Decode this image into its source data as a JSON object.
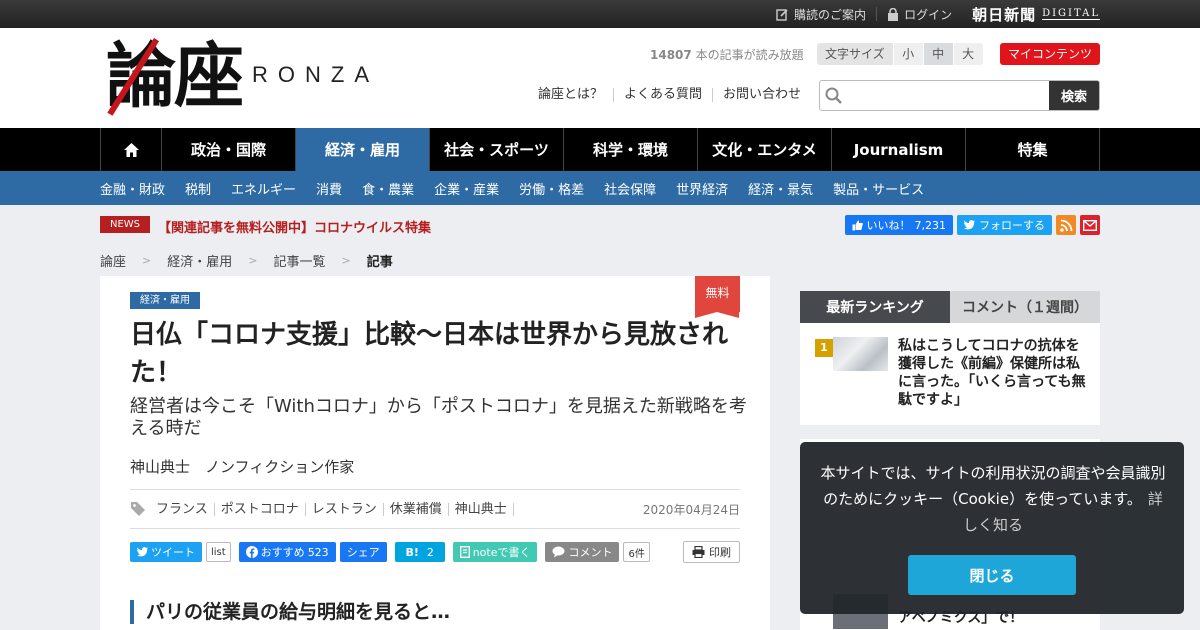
{
  "topbar": {
    "subscribe": "購読のご案内",
    "login": "ログイン",
    "asahi": "朝日新聞",
    "digital": "DIGITAL"
  },
  "header": {
    "logo_kanji": "論座",
    "logo_roman": "RONZA",
    "readers_count": "14807",
    "readers_suffix": " 本の記事が読み放題",
    "fontsize_label": "文字サイズ",
    "fontsize_options": [
      "小",
      "中",
      "大"
    ],
    "fontsize_selected": "中",
    "mycontents": "マイコンテンツ",
    "links": [
      "論座とは？",
      "よくある質問",
      "お問い合わせ"
    ],
    "search_placeholder": "",
    "search_button": "検索"
  },
  "nav": {
    "items": [
      "政治・国際",
      "経済・雇用",
      "社会・スポーツ",
      "科学・環境",
      "文化・エンタメ",
      "Journalism",
      "特集"
    ],
    "active": "経済・雇用"
  },
  "subnav": {
    "items": [
      "金融・財政",
      "税制",
      "エネルギー",
      "消費",
      "食・農業",
      "企業・産業",
      "労働・格差",
      "社会保障",
      "世界経済",
      "経済・景気",
      "製品・サービス"
    ]
  },
  "news": {
    "badge": "NEWS",
    "text": "【関連記事を無料公開中】コロナウイルス特集"
  },
  "social": {
    "fb_label": "いいね！",
    "fb_count": "7,231",
    "tw_label": "フォローする"
  },
  "breadcrumb": [
    "論座",
    "経済・雇用",
    "記事一覧",
    "記事"
  ],
  "article": {
    "category": "経済・雇用",
    "free_badge": "無料",
    "title": "日仏「コロナ支援」比較～日本は世界から見放された！",
    "subtitle": "経営者は今こそ「Withコロナ」から「ポストコロナ」を見据えた新戦略を考える時だ",
    "author": "神山典士　ノンフィクション作家",
    "tags": [
      "フランス",
      "ポストコロナ",
      "レストラン",
      "休業補償",
      "神山典士"
    ],
    "date": "2020年04月24日",
    "share": {
      "tweet": "ツイート",
      "list": "list",
      "fb_recommend": "おすすめ",
      "fb_count": "523",
      "fb_share": "シェア",
      "hatena": "B!",
      "hatena_count": "2",
      "note": "noteで書く",
      "comment": "コメント",
      "comment_count": "6件",
      "print": "印刷"
    },
    "section_heading": "パリの従業員の給与明細を見ると…"
  },
  "sidebar": {
    "tabs": [
      "最新ランキング",
      "コメント（１週間）"
    ],
    "active_tab": "最新ランキング",
    "ranking": [
      {
        "rank": "1",
        "title": "私はこうしてコロナの抗体を獲得した《前編》保健所は私に言った。「いくら言っても無駄ですよ」"
      }
    ],
    "partial_item_title": "アベノミクス」で！"
  },
  "cookie": {
    "message": "本サイトでは、サイトの利用状況の調査や会員識別のためにクッキー（Cookie）を使っています。",
    "more": "詳しく知る",
    "close": "閉じる"
  },
  "colors": {
    "brand_red": "#c4161c",
    "nav_active": "#2e6ba5",
    "mycontents": "#e0151c",
    "free_badge": "#e0453e",
    "cookie_button": "#1fa6d8"
  }
}
